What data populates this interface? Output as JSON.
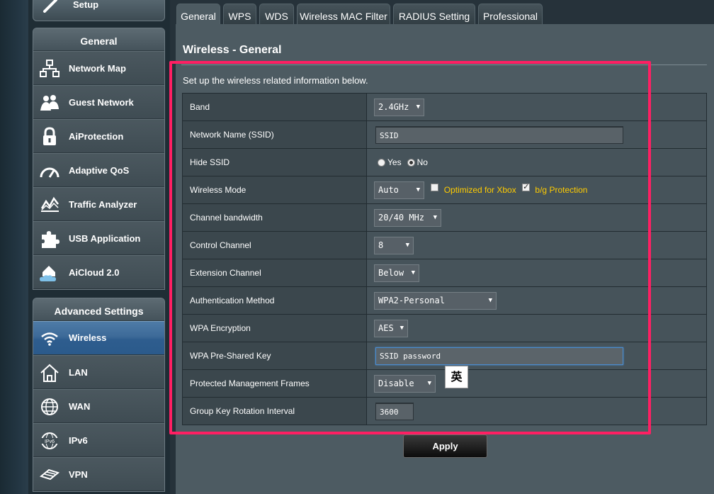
{
  "sidebar": {
    "setup_label": "Setup",
    "general": {
      "title": "General",
      "items": [
        {
          "label": "Network Map",
          "icon": "network-map-icon"
        },
        {
          "label": "Guest Network",
          "icon": "guest-network-icon"
        },
        {
          "label": "AiProtection",
          "icon": "lock-icon"
        },
        {
          "label": "Adaptive QoS",
          "icon": "speedometer-icon"
        },
        {
          "label": "Traffic Analyzer",
          "icon": "traffic-chart-icon"
        },
        {
          "label": "USB Application",
          "icon": "puzzle-icon"
        },
        {
          "label": "AiCloud 2.0",
          "icon": "cloud-house-icon"
        }
      ]
    },
    "advanced": {
      "title": "Advanced Settings",
      "items": [
        {
          "label": "Wireless",
          "icon": "wifi-icon",
          "active": true
        },
        {
          "label": "LAN",
          "icon": "house-icon"
        },
        {
          "label": "WAN",
          "icon": "globe-icon"
        },
        {
          "label": "IPv6",
          "icon": "ipv6-globe-icon"
        },
        {
          "label": "VPN",
          "icon": "vpn-icon"
        }
      ]
    }
  },
  "tabs": [
    "General",
    "WPS",
    "WDS",
    "Wireless MAC Filter",
    "RADIUS Setting",
    "Professional"
  ],
  "active_tab": "General",
  "page": {
    "title": "Wireless - General",
    "description": "Set up the wireless related information below."
  },
  "settings": {
    "band": {
      "label": "Band",
      "value": "2.4GHz"
    },
    "ssid": {
      "label": "Network Name (SSID)",
      "value": "SSID"
    },
    "hide_ssid": {
      "label": "Hide SSID",
      "yes": "Yes",
      "no": "No",
      "selected": "No"
    },
    "wireless_mode": {
      "label": "Wireless Mode",
      "value": "Auto",
      "xbox_label": "Optimized for Xbox",
      "xbox_checked": false,
      "bg_label": "b/g Protection",
      "bg_checked": true
    },
    "channel_bandwidth": {
      "label": "Channel bandwidth",
      "value": "20/40 MHz"
    },
    "control_channel": {
      "label": "Control Channel",
      "value": "8"
    },
    "extension_channel": {
      "label": "Extension Channel",
      "value": "Below"
    },
    "auth_method": {
      "label": "Authentication Method",
      "value": "WPA2-Personal"
    },
    "wpa_encryption": {
      "label": "WPA Encryption",
      "value": "AES"
    },
    "wpa_psk": {
      "label": "WPA Pre-Shared Key",
      "value": "SSID password"
    },
    "pmf": {
      "label": "Protected Management Frames",
      "value": "Disable"
    },
    "group_key": {
      "label": "Group Key Rotation Interval",
      "value": "3600"
    }
  },
  "ime_indicator": "英",
  "apply_label": "Apply",
  "colors": {
    "highlight": "#ff1f63",
    "accent_yellow": "#ffcc00",
    "active_item": "#2e5d8e"
  }
}
